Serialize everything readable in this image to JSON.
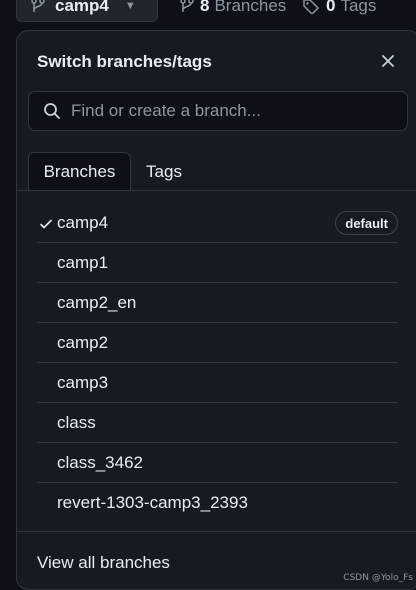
{
  "topbar": {
    "branch_name": "camp4",
    "branches_count": "8",
    "branches_label": "Branches",
    "tags_count": "0",
    "tags_label": "Tags"
  },
  "dialog": {
    "title": "Switch branches/tags",
    "search_placeholder": "Find or create a branch...",
    "tabs": [
      {
        "label": "Branches",
        "active": true
      },
      {
        "label": "Tags",
        "active": false
      }
    ],
    "branches": [
      {
        "name": "camp4",
        "selected": true,
        "badge": "default"
      },
      {
        "name": "camp1"
      },
      {
        "name": "camp2_en"
      },
      {
        "name": "camp2"
      },
      {
        "name": "camp3"
      },
      {
        "name": "class"
      },
      {
        "name": "class_3462"
      },
      {
        "name": "revert-1303-camp3_2393"
      }
    ],
    "footer_link": "View all branches"
  },
  "watermark": "CSDN @Yolo_Fs",
  "colors": {
    "background": "#0d1117",
    "panel": "#161b22",
    "border": "#30363d",
    "text": "#e6edf3",
    "muted": "#8d96a0"
  }
}
